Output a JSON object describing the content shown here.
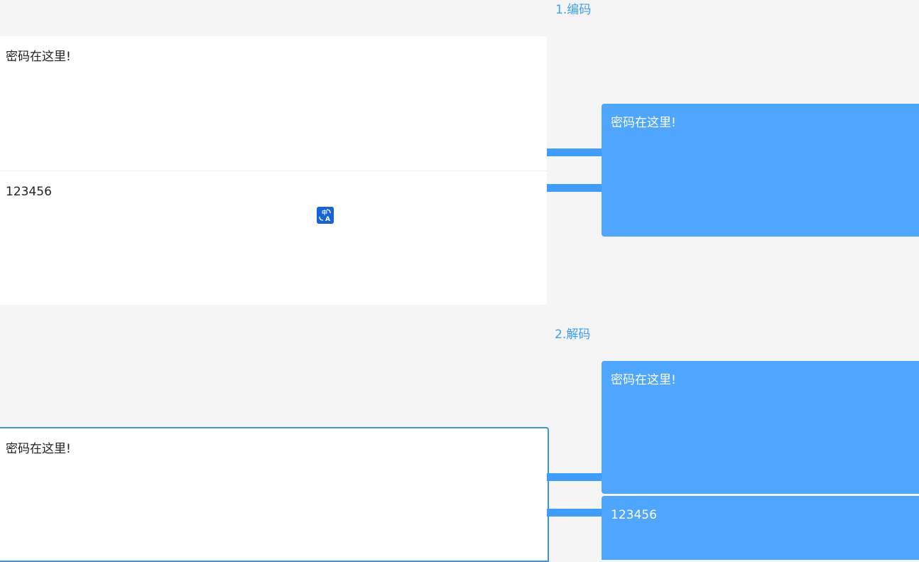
{
  "steps": {
    "encode_label": "1.编码",
    "decode_label": "2.解码"
  },
  "encode": {
    "message_input_value": "密码在这里!",
    "key_input_value": "123456",
    "output_value": "密码在这里!"
  },
  "decode": {
    "input_value": "密码在这里!",
    "output_message_value": "密码在这里!",
    "output_key_value": "123456"
  },
  "icons": {
    "translate": "translate-icon"
  },
  "colors": {
    "accent": "#3f9dfd",
    "output_panel": "#4ea6ff",
    "background": "#f5f5f5"
  }
}
